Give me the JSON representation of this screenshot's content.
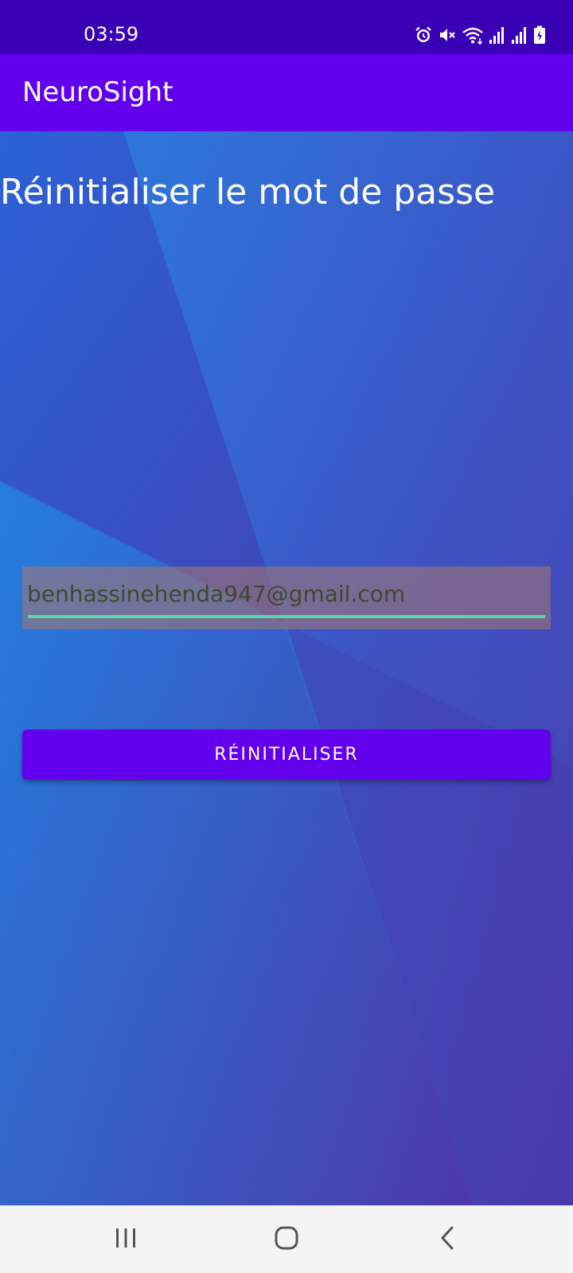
{
  "status_bar": {
    "time": "03:59",
    "icons": [
      "alarm-icon",
      "mute-icon",
      "wifi-icon",
      "signal-icon",
      "signal-icon",
      "battery-icon"
    ]
  },
  "app_bar": {
    "title": "NeuroSight"
  },
  "main": {
    "heading": "Réinitialiser le mot de passe",
    "email_value": "benhassinehenda947@gmail.com",
    "reset_button_label": "RÉINITIALISER"
  },
  "nav_bar": {
    "icons": [
      "recent-apps-icon",
      "home-icon",
      "back-icon"
    ]
  },
  "colors": {
    "status_bar": "#3a00b5",
    "app_bar": "#6200ee",
    "button": "#6200ee",
    "field_underline": "#5fd3a8"
  }
}
